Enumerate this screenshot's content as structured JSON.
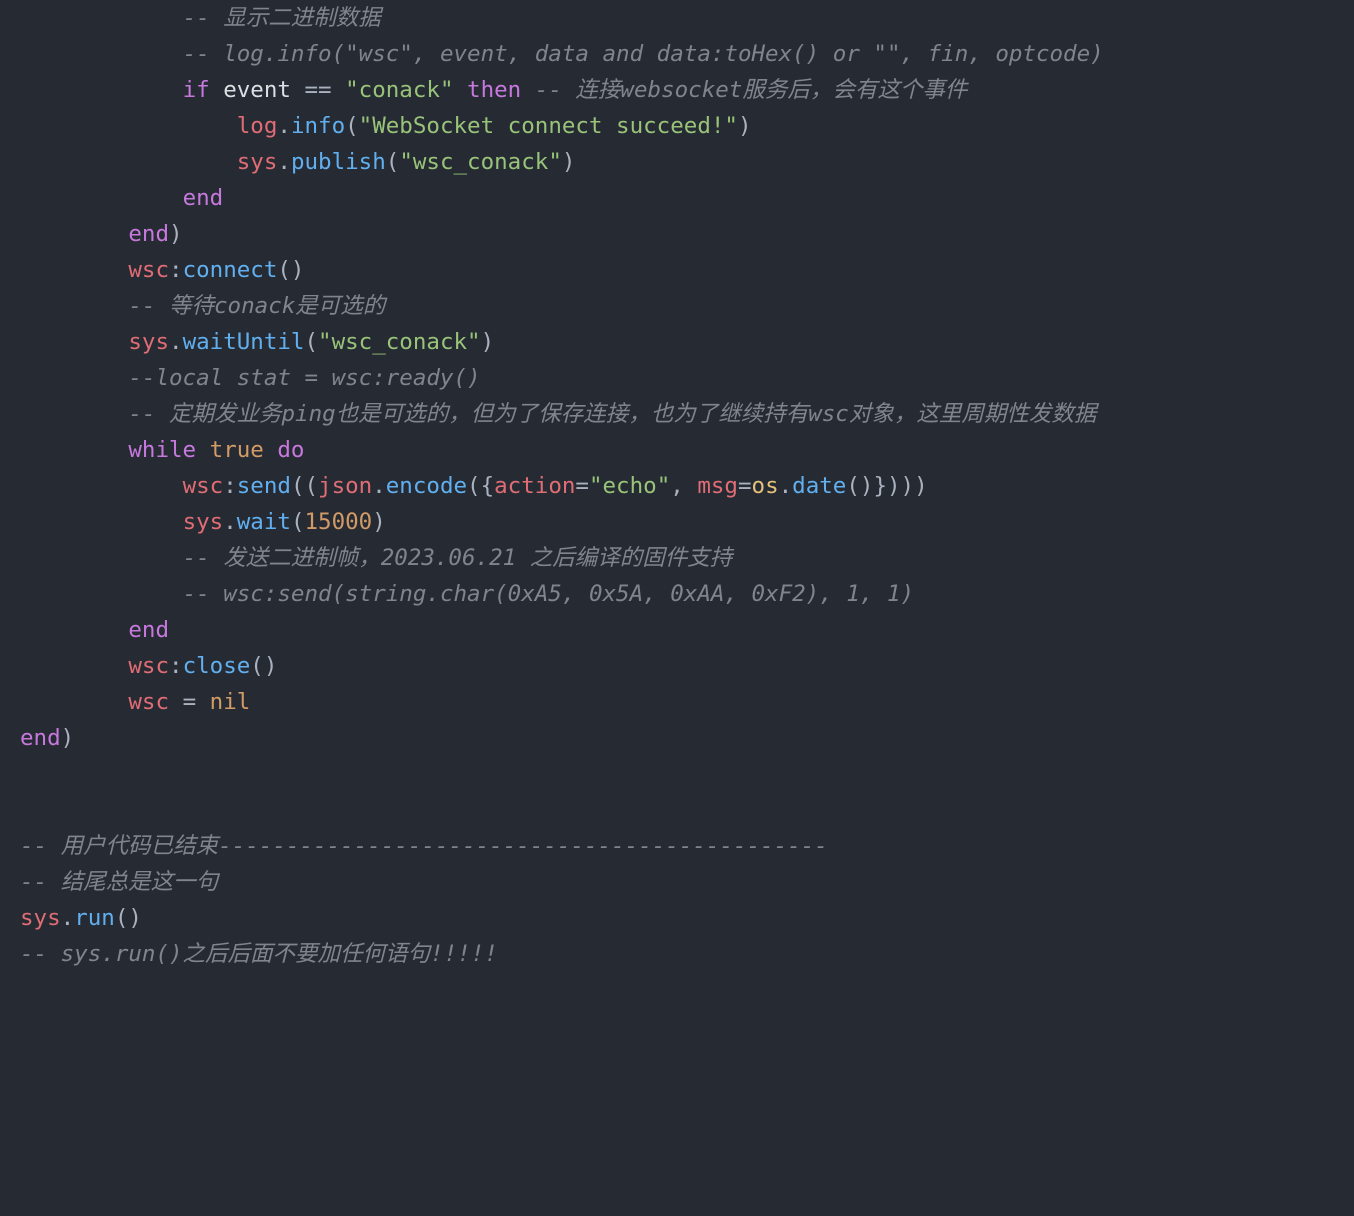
{
  "code": {
    "l01": "            -- 显示二进制数据",
    "l02": "            -- log.info(\"wsc\", event, data and data:toHex() or \"\", fin, optcode)",
    "l03_indent": "            ",
    "l03_if": "if",
    "l03_sp1": " ",
    "l03_event": "event",
    "l03_sp2": " ",
    "l03_eq": "==",
    "l03_sp3": " ",
    "l03_conack": "\"conack\"",
    "l03_sp4": " ",
    "l03_then": "then",
    "l03_sp5": " ",
    "l03_cmt": "-- 连接websocket服务后，会有这个事件",
    "l04_indent": "                ",
    "l04_log": "log",
    "l04_dot": ".",
    "l04_info": "info",
    "l04_open": "(",
    "l04_str": "\"WebSocket connect succeed!\"",
    "l04_close": ")",
    "l05_indent": "                ",
    "l05_sys": "sys",
    "l05_dot": ".",
    "l05_pub": "publish",
    "l05_open": "(",
    "l05_str": "\"wsc_conack\"",
    "l05_close": ")",
    "l06_indent": "            ",
    "l06_end": "end",
    "l07_indent": "        ",
    "l07_end": "end",
    "l07_paren": ")",
    "l08_indent": "        ",
    "l08_wsc": "wsc",
    "l08_colon": ":",
    "l08_connect": "connect",
    "l08_p": "()",
    "l09": "        -- 等待conack是可选的",
    "l10_indent": "        ",
    "l10_sys": "sys",
    "l10_dot": ".",
    "l10_wait": "waitUntil",
    "l10_open": "(",
    "l10_str": "\"wsc_conack\"",
    "l10_close": ")",
    "l11": "        --local stat = wsc:ready()",
    "l12": "        -- 定期发业务ping也是可选的，但为了保存连接，也为了继续持有wsc对象，这里周期性发数据",
    "l13_indent": "        ",
    "l13_while": "while",
    "l13_sp1": " ",
    "l13_true": "true",
    "l13_sp2": " ",
    "l13_do": "do",
    "l14_indent": "            ",
    "l14_wsc": "wsc",
    "l14_colon": ":",
    "l14_send": "send",
    "l14_o1": "((",
    "l14_json": "json",
    "l14_dot1": ".",
    "l14_enc": "encode",
    "l14_o2": "({",
    "l14_act": "action",
    "l14_eq1": "=",
    "l14_str": "\"echo\"",
    "l14_comma": ", ",
    "l14_msg": "msg",
    "l14_eq2": "=",
    "l14_os": "os",
    "l14_dot2": ".",
    "l14_date": "date",
    "l14_o3": "()})))",
    "l15_indent": "            ",
    "l15_sys": "sys",
    "l15_dot": ".",
    "l15_wait": "wait",
    "l15_open": "(",
    "l15_num": "15000",
    "l15_close": ")",
    "l16": "            -- 发送二进制帧，2023.06.21 之后编译的固件支持",
    "l17": "            -- wsc:send(string.char(0xA5, 0x5A, 0xAA, 0xF2), 1, 1)",
    "l18_indent": "        ",
    "l18_end": "end",
    "l19_indent": "        ",
    "l19_wsc": "wsc",
    "l19_colon": ":",
    "l19_close": "close",
    "l19_p": "()",
    "l20_indent": "        ",
    "l20_wsc": "wsc",
    "l20_sp1": " ",
    "l20_eq": "=",
    "l20_sp2": " ",
    "l20_nil": "nil",
    "l21_end": "end",
    "l21_p": ")",
    "blank1": "",
    "blank2": "",
    "l22": "-- 用户代码已结束---------------------------------------------",
    "l23": "-- 结尾总是这一句",
    "l24_sys": "sys",
    "l24_dot": ".",
    "l24_run": "run",
    "l24_p": "()",
    "l25": "-- sys.run()之后后面不要加任何语句!!!!!"
  }
}
